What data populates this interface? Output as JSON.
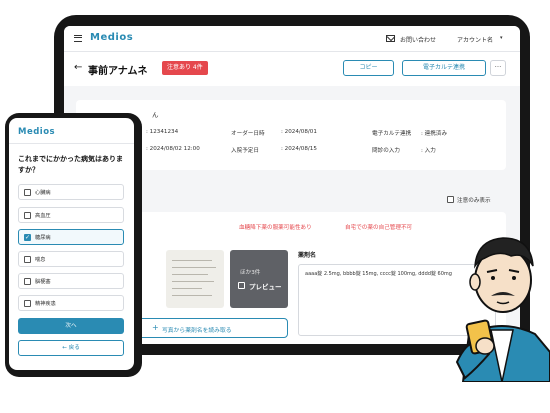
{
  "colors": {
    "brand": "#2a8bb3",
    "alert": "#e5484d"
  },
  "tablet": {
    "logo": "Medios",
    "header": {
      "inquiry": "お問い合わせ",
      "account": "アカウント名",
      "caret": "▾",
      "menu_icon": "hamburger-icon",
      "mail_icon": "mail-icon"
    },
    "title": {
      "back": "←",
      "text": "事前アナムネ",
      "badge": "注意あり 4件"
    },
    "actions": {
      "copy": "コピー",
      "ehr_link": "電子カルテ連携",
      "more": "···"
    },
    "patient": {
      "name_fragment": "ん",
      "rows": [
        {
          "label": "",
          "value": ": 12341234"
        },
        {
          "label": "",
          "value": ": 2024/08/02 12:00"
        },
        {
          "label": "オーダー日時",
          "value": ": 2024/08/01"
        },
        {
          "label": "入院予定日",
          "value": ": 2024/08/15"
        },
        {
          "label": "電子カルテ連携",
          "value": ": 連携済み"
        },
        {
          "label": "問診の入力",
          "value": ": 入力"
        }
      ]
    },
    "only_attention": "注意のみ表示",
    "warnings": [
      "血糖降下薬の服薬可能性あり",
      "自宅での薬の自己管理不可"
    ],
    "photos": {
      "more": "ほか3件",
      "preview": "プレビュー"
    },
    "read_button": "写真から薬剤名を読み取る",
    "drug": {
      "label": "薬剤名",
      "value": "aaaa錠 2.5mg, bbbb錠 15mg, cccc錠 100mg, dddd錠 60mg"
    }
  },
  "phone": {
    "logo": "Medios",
    "question": "これまでにかかった病気はありますか？",
    "options": [
      {
        "label": "心臓病",
        "checked": false
      },
      {
        "label": "高血圧",
        "checked": false
      },
      {
        "label": "糖尿病",
        "checked": true
      },
      {
        "label": "喘息",
        "checked": false
      },
      {
        "label": "脳梗塞",
        "checked": false
      },
      {
        "label": "精神疾患",
        "checked": false
      }
    ],
    "next": "次へ",
    "back": "← 戻る"
  }
}
